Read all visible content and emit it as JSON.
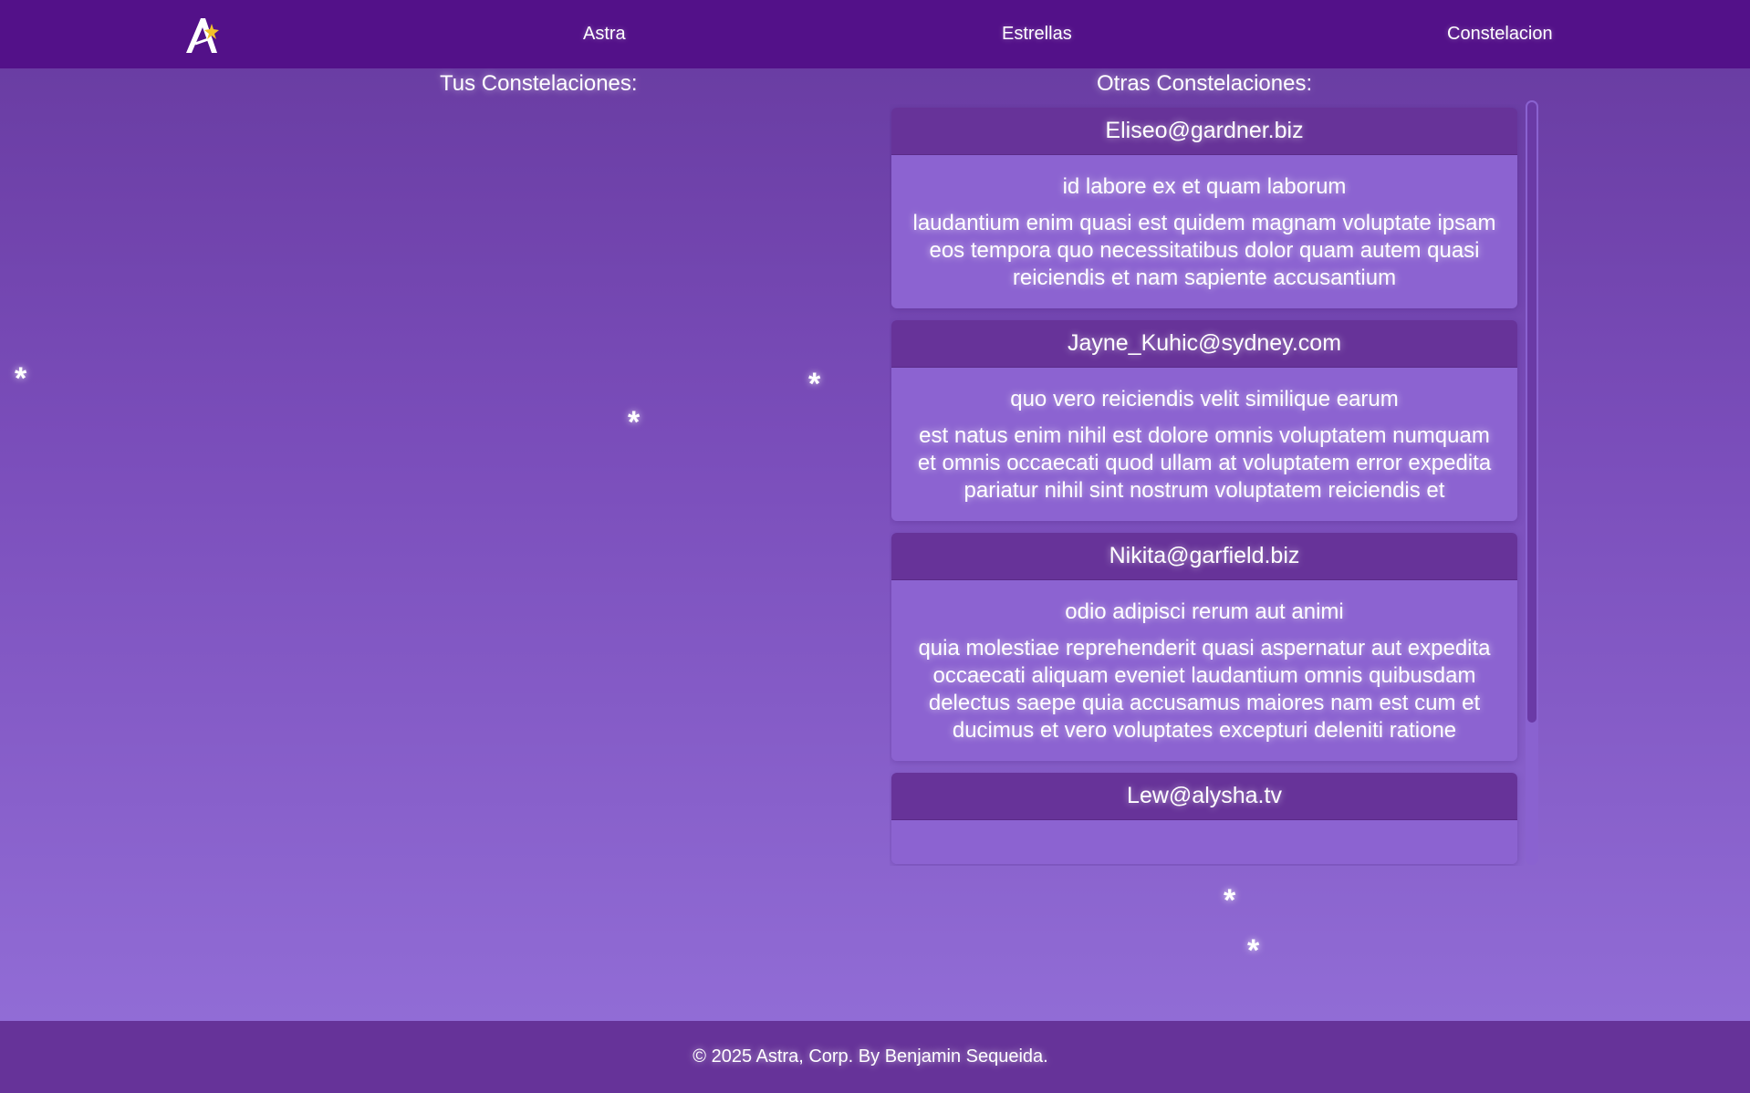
{
  "nav": {
    "logo_icon": "astra-logo-icon",
    "links": [
      "Astra",
      "Estrellas",
      "Constelacion"
    ]
  },
  "sections": {
    "yours_title": "Tus Constelaciones:",
    "others_title": "Otras Constelaciones:"
  },
  "constellations": [
    {
      "author": "Eliseo@gardner.biz",
      "title": "id labore ex et quam laborum",
      "body": "laudantium enim quasi est quidem magnam voluptate ipsam eos tempora quo necessitatibus dolor quam autem quasi reiciendis et nam sapiente accusantium"
    },
    {
      "author": "Jayne_Kuhic@sydney.com",
      "title": "quo vero reiciendis velit similique earum",
      "body": "est natus enim nihil est dolore omnis voluptatem numquam et omnis occaecati quod ullam at voluptatem error expedita pariatur nihil sint nostrum voluptatem reiciendis et"
    },
    {
      "author": "Nikita@garfield.biz",
      "title": "odio adipisci rerum aut animi",
      "body": "quia molestiae reprehenderit quasi aspernatur aut expedita occaecati aliquam eveniet laudantium omnis quibusdam delectus saepe quia accusamus maiores nam est cum et ducimus et vero voluptates excepturi deleniti ratione"
    },
    {
      "author": "Lew@alysha.tv",
      "title": "",
      "body": ""
    }
  ],
  "stars": [
    "*",
    "*",
    "*",
    "*",
    "*"
  ],
  "footer": {
    "text": "© 2025 Astra, Corp. By Benjamin Sequeida."
  },
  "colors": {
    "navbar": "#531189",
    "card_header": "#673399",
    "card_body": "#8c63d1",
    "footer": "#663399"
  }
}
